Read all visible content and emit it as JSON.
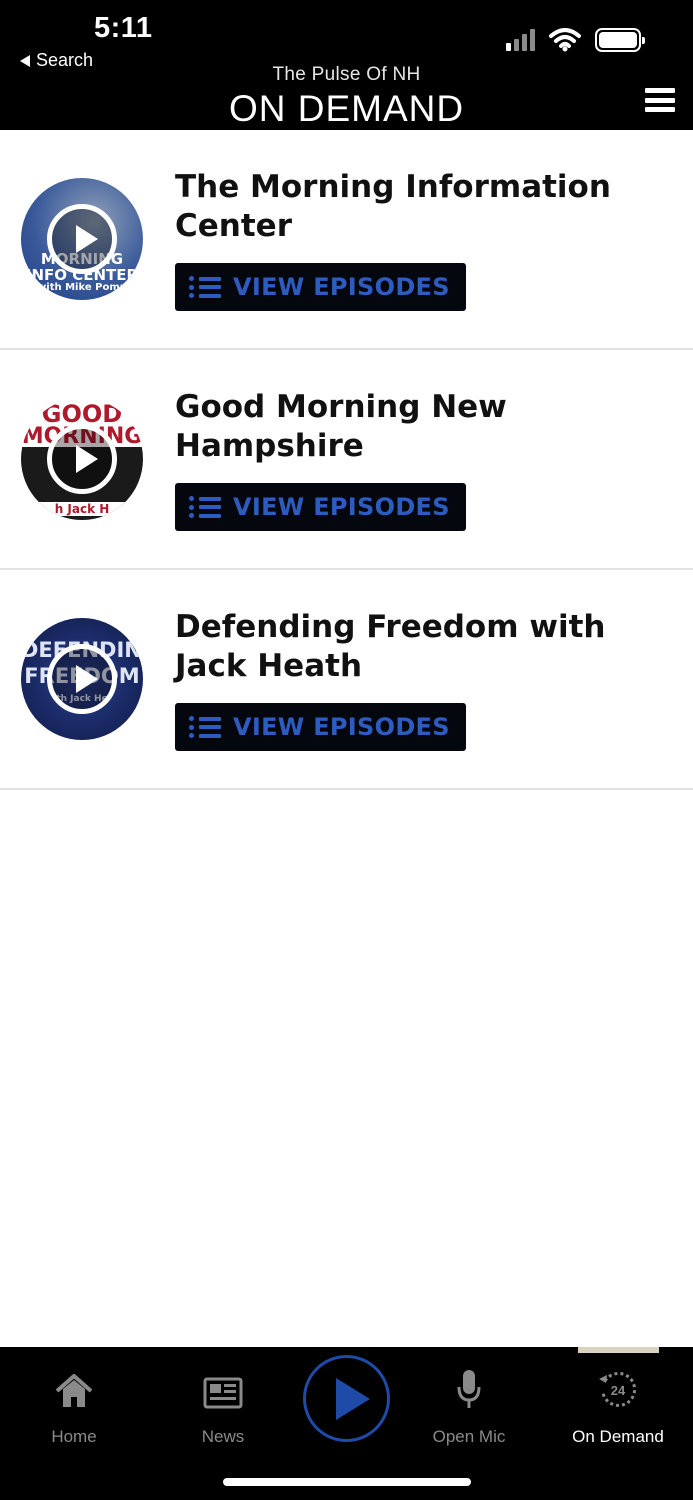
{
  "status_bar": {
    "time": "5:11",
    "back_label": "Search"
  },
  "header": {
    "subtitle": "The Pulse Of NH",
    "title": "ON DEMAND"
  },
  "shows": [
    {
      "title": "The Morning Information Center",
      "button_label": "VIEW EPISODES",
      "thumb_lines": [
        "MORNING",
        "INFO CENTER",
        "with Mike Pomp"
      ]
    },
    {
      "title": "Good Morning New Hampshire",
      "button_label": "VIEW EPISODES",
      "thumb_lines": [
        "GOOD",
        "MORNING",
        "h Jack H"
      ]
    },
    {
      "title": "Defending Freedom with Jack Heath",
      "button_label": "VIEW EPISODES",
      "thumb_lines": [
        "DEFENDING",
        "FREEDOM",
        "th Jack He"
      ]
    }
  ],
  "tabbar": {
    "items": [
      {
        "label": "Home",
        "icon": "home-icon"
      },
      {
        "label": "News",
        "icon": "newspaper-icon"
      },
      {
        "label": "Open Mic",
        "icon": "microphone-icon"
      },
      {
        "label": "On Demand",
        "icon": "on-demand-24-icon"
      }
    ],
    "active": "On Demand",
    "center_icon": "play-icon"
  },
  "colors": {
    "accent_blue": "#2c5cc0",
    "header_bg": "#000000",
    "button_bg": "#05070f"
  }
}
